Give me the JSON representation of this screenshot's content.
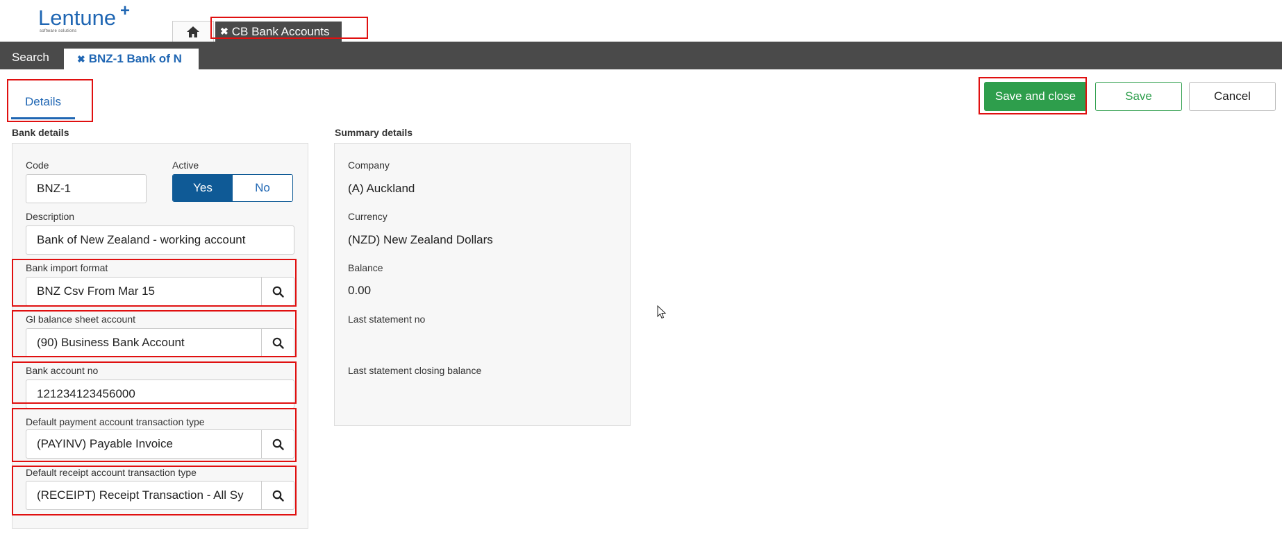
{
  "brand": {
    "name": "Lentune",
    "tagline": "software solutions"
  },
  "tabs": {
    "home_icon": "home-icon",
    "active_module": "CB Bank Accounts",
    "close_glyph": "✖"
  },
  "nav": {
    "search": "Search",
    "record_tab": "BNZ-1 Bank of N"
  },
  "page": {
    "details_tab": "Details"
  },
  "actions": {
    "save_and_close": "Save and close",
    "save": "Save",
    "cancel": "Cancel"
  },
  "bank_details": {
    "heading": "Bank details",
    "code_label": "Code",
    "code_value": "BNZ-1",
    "active_label": "Active",
    "active_yes": "Yes",
    "active_no": "No",
    "active_selected": "Yes",
    "description_label": "Description",
    "description_value": "Bank of New Zealand - working account",
    "import_format_label": "Bank import format",
    "import_format_value": "BNZ Csv From Mar 15",
    "gl_account_label": "Gl balance sheet account",
    "gl_account_value": "(90) Business Bank Account",
    "account_no_label": "Bank account no",
    "account_no_value": "121234123456000",
    "payment_type_label": "Default payment account transaction type",
    "payment_type_value": "(PAYINV) Payable Invoice",
    "receipt_type_label": "Default receipt account transaction type",
    "receipt_type_value": "(RECEIPT) Receipt Transaction - All Sy"
  },
  "summary": {
    "heading": "Summary details",
    "company_label": "Company",
    "company_value": "(A) Auckland",
    "currency_label": "Currency",
    "currency_value": "(NZD) New Zealand Dollars",
    "balance_label": "Balance",
    "balance_value": "0.00",
    "last_statement_no_label": "Last statement no",
    "last_statement_no_value": "",
    "last_closing_balance_label": "Last statement closing balance",
    "last_closing_balance_value": ""
  },
  "colors": {
    "brand_blue": "#1f66b3",
    "nav_dark": "#4a4a4a",
    "primary_green": "#2e9e4c",
    "toggle_blue": "#0f5a96",
    "highlight_red": "#e01010"
  }
}
